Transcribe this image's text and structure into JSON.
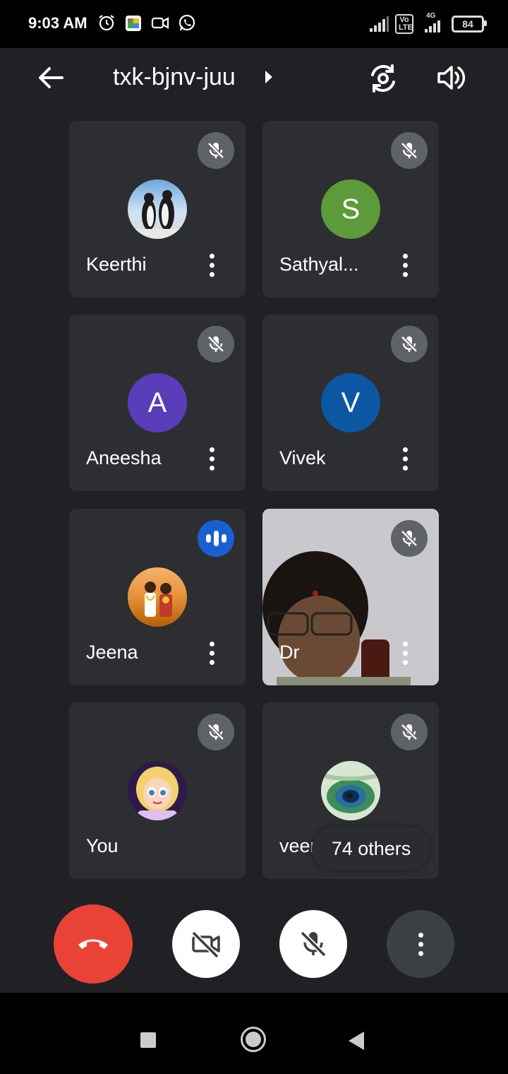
{
  "status_bar": {
    "time": "9:03 AM",
    "volte": "Vo LTE",
    "network": "4G",
    "battery": "84",
    "icons": [
      "alarm-icon",
      "meet-app-icon",
      "video-icon",
      "whatsapp-icon"
    ]
  },
  "header": {
    "meeting_code": "txk-bjnv-juu",
    "icons": [
      "back-arrow-icon",
      "switch-camera-icon",
      "speaker-icon"
    ]
  },
  "participants": [
    {
      "name": "Keerthi",
      "avatar_type": "image",
      "avatar_desc": "penguins-photo",
      "state": "muted"
    },
    {
      "name": "Sathyal...",
      "avatar_type": "letter",
      "letter": "S",
      "color": "#5d9a3a",
      "state": "muted"
    },
    {
      "name": "Aneesha",
      "avatar_type": "letter",
      "letter": "A",
      "color": "#5a3db8",
      "state": "muted"
    },
    {
      "name": "Vivek",
      "avatar_type": "letter",
      "letter": "V",
      "color": "#0b57a3",
      "state": "muted"
    },
    {
      "name": "Jeena",
      "avatar_type": "image",
      "avatar_desc": "couple-photo",
      "state": "speaking"
    },
    {
      "name": "Dr",
      "avatar_type": "video",
      "state": "muted"
    },
    {
      "name": "You",
      "avatar_type": "image",
      "avatar_desc": "cartoon-girl",
      "state": "muted"
    },
    {
      "name": "veena",
      "avatar_type": "image",
      "avatar_desc": "peacock-feather",
      "state": "muted"
    }
  ],
  "others_label": "74 others",
  "controls": [
    "end-call",
    "camera-off",
    "mic-off",
    "more-options"
  ],
  "colors": {
    "background": "#202124",
    "tile": "#2d2e31",
    "end_call": "#ea4335",
    "speaking": "#1a5fd1"
  }
}
